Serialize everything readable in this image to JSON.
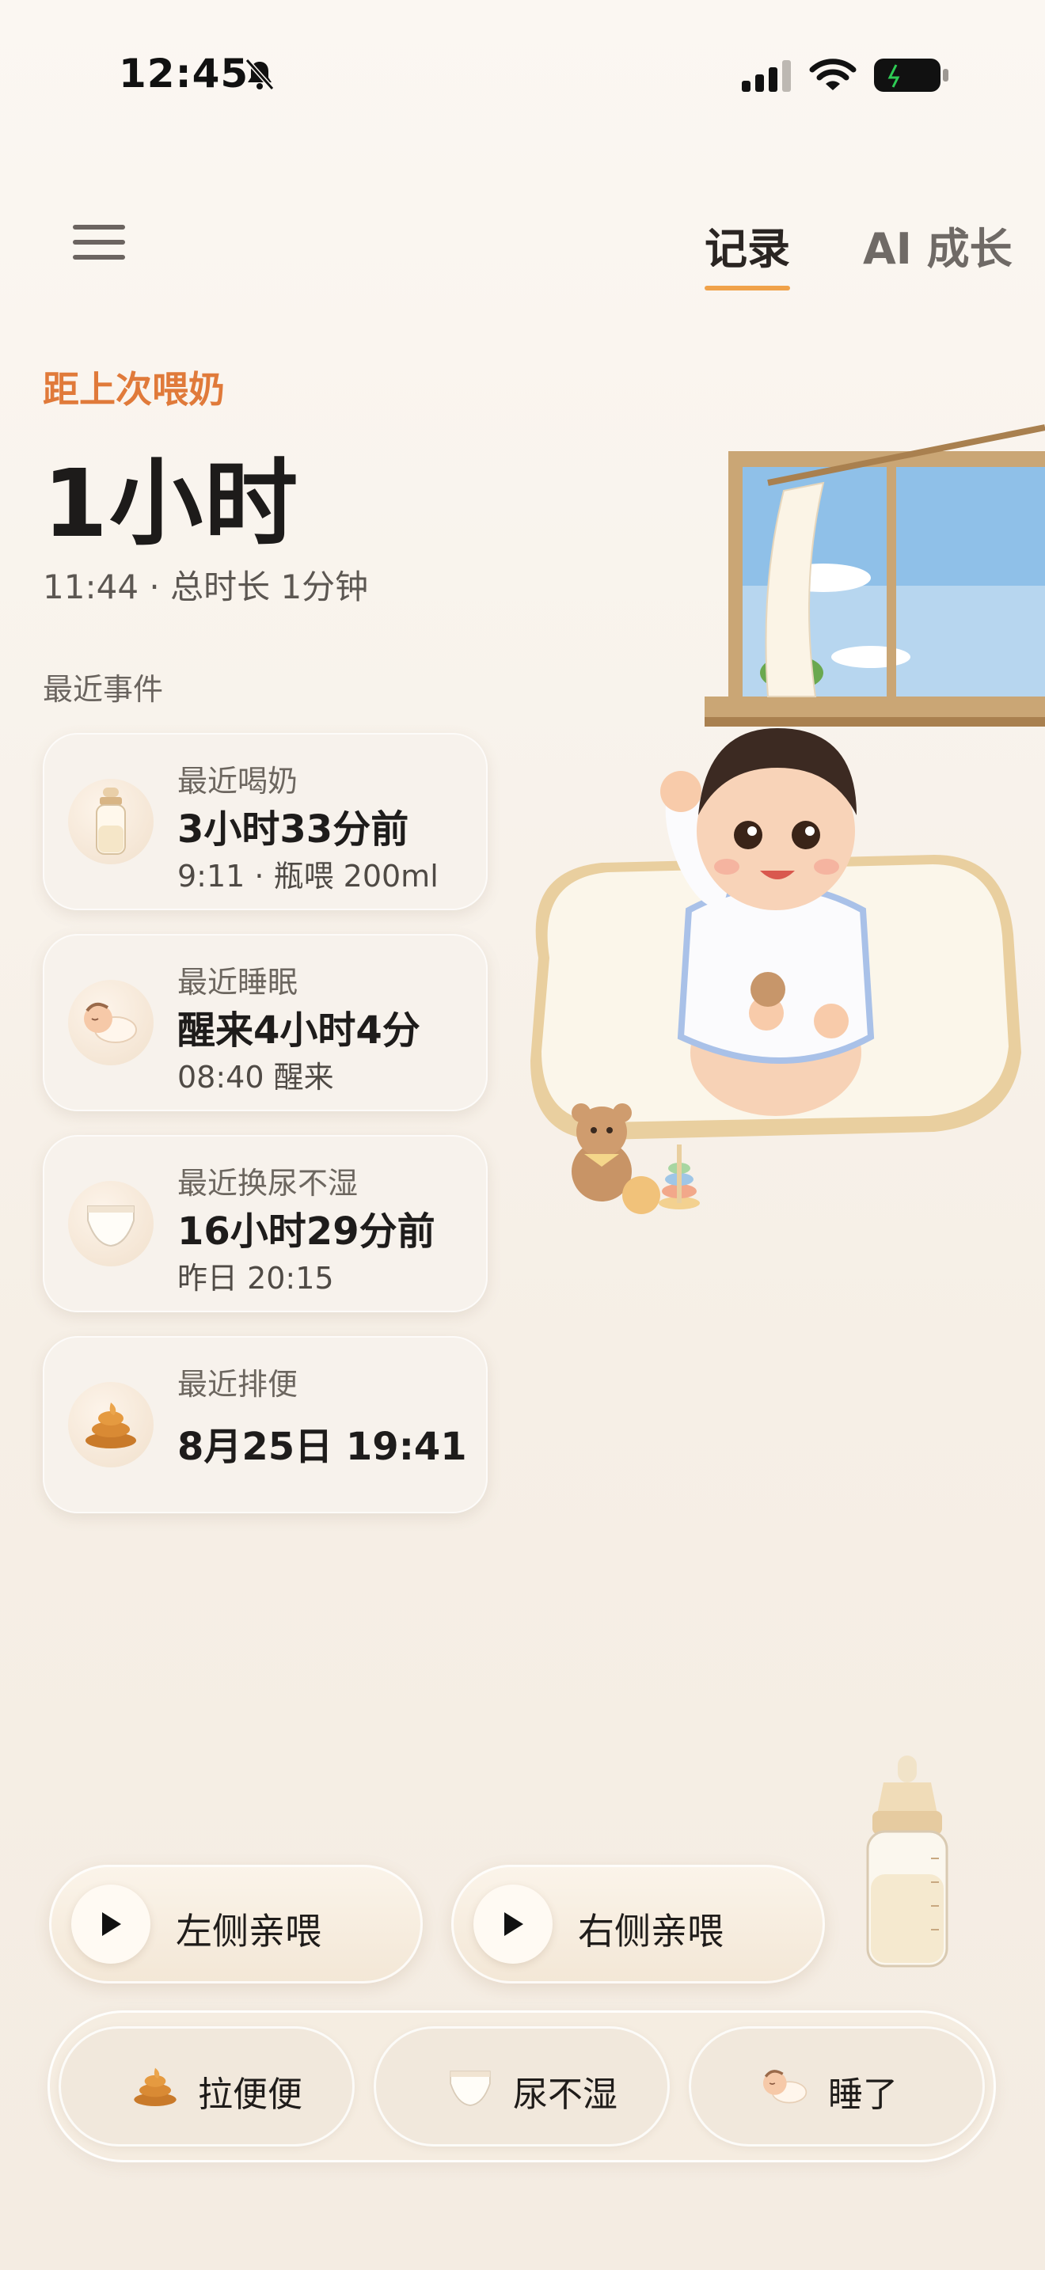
{
  "status": {
    "time": "12:45"
  },
  "header": {
    "tabs": [
      {
        "label": "记录",
        "active": true
      },
      {
        "label": "AI 成长",
        "active": false
      }
    ]
  },
  "summary": {
    "since_label": "距上次喂奶",
    "since_value": "1小时",
    "detail": "11:44 · 总时长 1分钟"
  },
  "events": {
    "title": "最近事件",
    "items": [
      {
        "icon": "bottle-icon",
        "title": "最近喝奶",
        "main": "3小时33分前",
        "sub": "9:11 · 瓶喂 200ml"
      },
      {
        "icon": "sleeping-baby-icon",
        "title": "最近睡眠",
        "main": "醒来4小时4分",
        "sub": "08:40 醒来"
      },
      {
        "icon": "diaper-icon",
        "title": "最近换尿不湿",
        "main": "16小时29分前",
        "sub": "昨日 20:15"
      },
      {
        "icon": "poop-icon",
        "title": "最近排便",
        "main": "8月25日 19:41",
        "sub": ""
      }
    ]
  },
  "feed": {
    "left_label": "左侧亲喂",
    "right_label": "右侧亲喂"
  },
  "actions": {
    "poop_label": "拉便便",
    "diaper_label": "尿不湿",
    "sleep_label": "睡了"
  },
  "colors": {
    "accent": "#f0a24a",
    "orange_text": "#e07a3a"
  }
}
